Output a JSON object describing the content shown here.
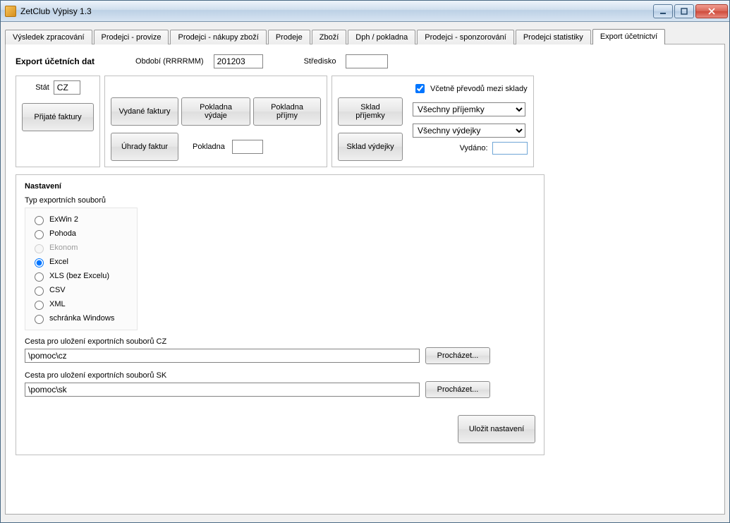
{
  "window": {
    "title": "ZetClub Výpisy 1.3"
  },
  "tabs": [
    {
      "label": "Výsledek zpracování"
    },
    {
      "label": "Prodejci - provize"
    },
    {
      "label": "Prodejci - nákupy zboží"
    },
    {
      "label": "Prodeje"
    },
    {
      "label": "Zboží"
    },
    {
      "label": "Dph / pokladna"
    },
    {
      "label": "Prodejci - sponzorování"
    },
    {
      "label": "Prodejci statistiky"
    },
    {
      "label": "Export účetnictví"
    }
  ],
  "header": {
    "title": "Export účetních dat",
    "period_label": "Období (RRRRMM)",
    "period_value": "201203",
    "center_label": "Středisko",
    "center_value": ""
  },
  "group1": {
    "state_label": "Stát",
    "state_value": "CZ",
    "btn_incoming": "Přijaté faktury"
  },
  "group2": {
    "btn_outgoing": "Vydané faktury",
    "btn_cash_out": "Pokladna výdaje",
    "btn_cash_in": "Pokladna příjmy",
    "btn_payments": "Úhrady faktur",
    "cash_label": "Pokladna",
    "cash_value": ""
  },
  "group3": {
    "btn_stock_in": "Sklad příjemky",
    "btn_stock_out": "Sklad výdejky",
    "chk_transfers": "Včetně převodů mezi sklady",
    "sel_in": "Všechny příjemky",
    "sel_out": "Všechny výdejky",
    "issued_label": "Vydáno:"
  },
  "settings": {
    "title": "Nastavení",
    "type_title": "Typ exportních souborů",
    "radios": [
      {
        "label": "ExWin 2",
        "disabled": false,
        "selected": false
      },
      {
        "label": "Pohoda",
        "disabled": false,
        "selected": false
      },
      {
        "label": "Ekonom",
        "disabled": true,
        "selected": false
      },
      {
        "label": "Excel",
        "disabled": false,
        "selected": true
      },
      {
        "label": "XLS (bez Excelu)",
        "disabled": false,
        "selected": false
      },
      {
        "label": "CSV",
        "disabled": false,
        "selected": false
      },
      {
        "label": "XML",
        "disabled": false,
        "selected": false
      },
      {
        "label": "schránka Windows",
        "disabled": false,
        "selected": false
      }
    ],
    "path_cz_label": "Cesta pro uložení exportních souborů CZ",
    "path_cz_value": "\\pomoc\\cz",
    "path_sk_label": "Cesta pro uložení exportních souborů SK",
    "path_sk_value": "\\pomoc\\sk",
    "browse": "Procházet...",
    "save": "Uložit nastavení"
  }
}
